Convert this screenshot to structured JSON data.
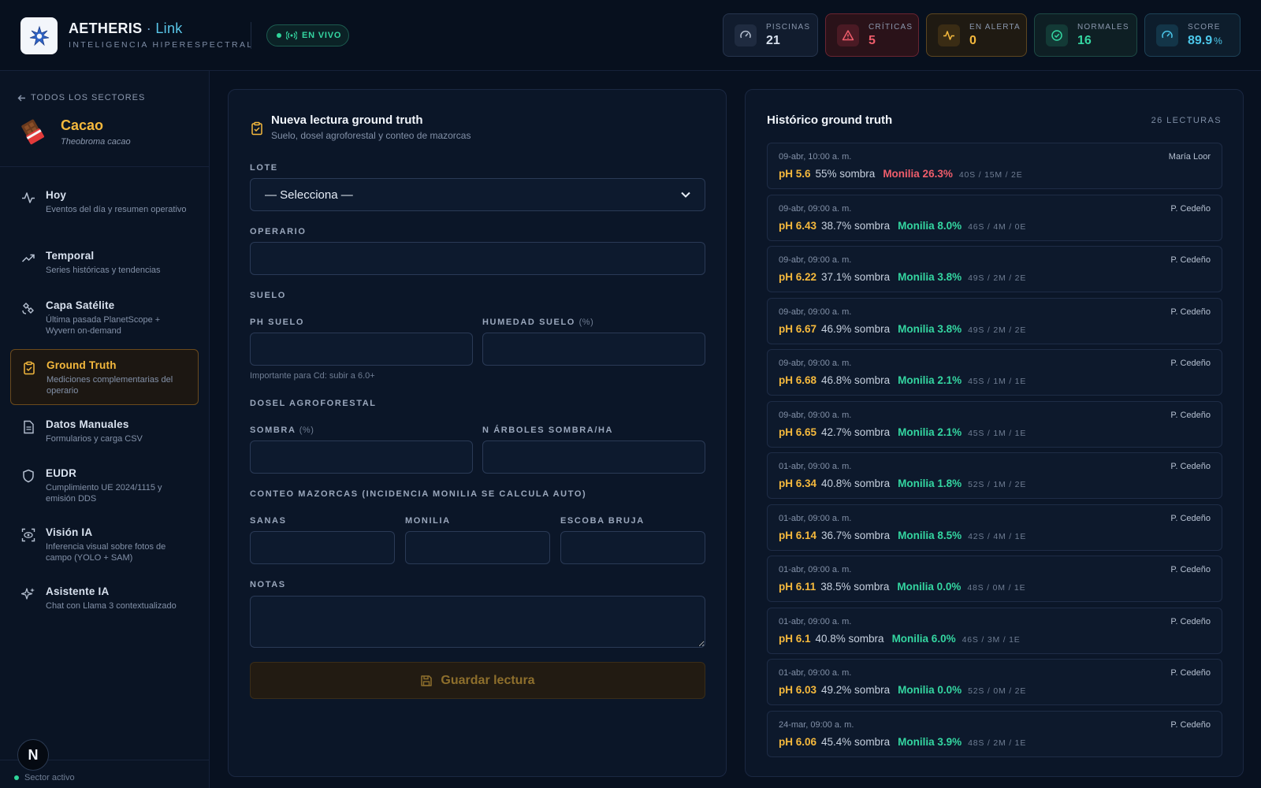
{
  "header": {
    "brand_name": "AETHERIS",
    "brand_sep": "·",
    "brand_link": "Link",
    "brand_sub": "INTELIGENCIA HIPERESPECTRAL",
    "live_label": "EN VIVO",
    "stats": [
      {
        "label": "PISCINAS",
        "value": "21",
        "suffix": "",
        "color": "#d8e1ee",
        "icon": "gauge-icon"
      },
      {
        "label": "CRÍTICAS",
        "value": "5",
        "suffix": "",
        "color": "#ef5d6b",
        "icon": "warning-icon"
      },
      {
        "label": "EN ALERTA",
        "value": "0",
        "suffix": "",
        "color": "#f5b93d",
        "icon": "activity-icon"
      },
      {
        "label": "NORMALES",
        "value": "16",
        "suffix": "",
        "color": "#34d6a1",
        "icon": "check-circle-icon"
      },
      {
        "label": "SCORE",
        "value": "89.9",
        "suffix": "%",
        "color": "#4cc7ea",
        "icon": "gauge-icon"
      }
    ]
  },
  "sidebar": {
    "back_label": "TODOS LOS SECTORES",
    "sector_name": "Cacao",
    "sector_sci": "Theobroma cacao",
    "items": [
      {
        "title": "Hoy",
        "desc": "Eventos del día y resumen operativo"
      },
      {
        "title": "Temporal",
        "desc": "Series históricas y tendencias"
      },
      {
        "title": "Capa Satélite",
        "desc": "Última pasada PlanetScope + Wyvern on-demand"
      },
      {
        "title": "Ground Truth",
        "desc": "Mediciones complementarias del operario"
      },
      {
        "title": "Datos Manuales",
        "desc": "Formularios y carga CSV"
      },
      {
        "title": "EUDR",
        "desc": "Cumplimiento UE 2024/1115 y emisión DDS"
      },
      {
        "title": "Visión IA",
        "desc": "Inferencia visual sobre fotos de campo (YOLO + SAM)"
      },
      {
        "title": "Asistente IA",
        "desc": "Chat con Llama 3 contextualizado"
      }
    ],
    "badge": "N",
    "status": "Sector activo"
  },
  "form": {
    "title": "Nueva lectura ground truth",
    "subtitle": "Suelo, dosel agroforestal y conteo de mazorcas",
    "lote_label": "LOTE",
    "lote_value": "— Selecciona —",
    "operario_label": "OPERARIO",
    "suelo_section": "SUELO",
    "ph_label": "PH SUELO",
    "humedad_label": "HUMEDAD SUELO",
    "humedad_unit": "(%)",
    "ph_hint": "Importante para Cd: subir a 6.0+",
    "dosel_section": "DOSEL AGROFORESTAL",
    "sombra_label": "SOMBRA",
    "sombra_unit": "(%)",
    "arboles_label": "N ÁRBOLES SOMBRA/HA",
    "conteo_section": "CONTEO MAZORCAS (INCIDENCIA MONILIA SE CALCULA AUTO)",
    "sanas_label": "SANAS",
    "monilia_label": "MONILIA",
    "escoba_label": "ESCOBA BRUJA",
    "notas_label": "NOTAS",
    "save_label": "Guardar lectura"
  },
  "history": {
    "title": "Histórico ground truth",
    "count": "26 LECTURAS",
    "records": [
      {
        "date": "09-abr, 10:00 a. m.",
        "op": "María Loor",
        "ph": "pH 5.6",
        "sombra": "55% sombra",
        "mon": "Monilia 26.3%",
        "mon_color": "#ef5d6b",
        "counts": "40S / 15M / 2E"
      },
      {
        "date": "09-abr, 09:00 a. m.",
        "op": "P. Cedeño",
        "ph": "pH 6.43",
        "sombra": "38.7% sombra",
        "mon": "Monilia 8.0%",
        "mon_color": "#34d6a1",
        "counts": "46S / 4M / 0E"
      },
      {
        "date": "09-abr, 09:00 a. m.",
        "op": "P. Cedeño",
        "ph": "pH 6.22",
        "sombra": "37.1% sombra",
        "mon": "Monilia 3.8%",
        "mon_color": "#34d6a1",
        "counts": "49S / 2M / 2E"
      },
      {
        "date": "09-abr, 09:00 a. m.",
        "op": "P. Cedeño",
        "ph": "pH 6.67",
        "sombra": "46.9% sombra",
        "mon": "Monilia 3.8%",
        "mon_color": "#34d6a1",
        "counts": "49S / 2M / 2E"
      },
      {
        "date": "09-abr, 09:00 a. m.",
        "op": "P. Cedeño",
        "ph": "pH 6.68",
        "sombra": "46.8% sombra",
        "mon": "Monilia 2.1%",
        "mon_color": "#34d6a1",
        "counts": "45S / 1M / 1E"
      },
      {
        "date": "09-abr, 09:00 a. m.",
        "op": "P. Cedeño",
        "ph": "pH 6.65",
        "sombra": "42.7% sombra",
        "mon": "Monilia 2.1%",
        "mon_color": "#34d6a1",
        "counts": "45S / 1M / 1E"
      },
      {
        "date": "01-abr, 09:00 a. m.",
        "op": "P. Cedeño",
        "ph": "pH 6.34",
        "sombra": "40.8% sombra",
        "mon": "Monilia 1.8%",
        "mon_color": "#34d6a1",
        "counts": "52S / 1M / 2E"
      },
      {
        "date": "01-abr, 09:00 a. m.",
        "op": "P. Cedeño",
        "ph": "pH 6.14",
        "sombra": "36.7% sombra",
        "mon": "Monilia 8.5%",
        "mon_color": "#34d6a1",
        "counts": "42S / 4M / 1E"
      },
      {
        "date": "01-abr, 09:00 a. m.",
        "op": "P. Cedeño",
        "ph": "pH 6.11",
        "sombra": "38.5% sombra",
        "mon": "Monilia 0.0%",
        "mon_color": "#34d6a1",
        "counts": "48S / 0M / 1E"
      },
      {
        "date": "01-abr, 09:00 a. m.",
        "op": "P. Cedeño",
        "ph": "pH 6.1",
        "sombra": "40.8% sombra",
        "mon": "Monilia 6.0%",
        "mon_color": "#34d6a1",
        "counts": "46S / 3M / 1E"
      },
      {
        "date": "01-abr, 09:00 a. m.",
        "op": "P. Cedeño",
        "ph": "pH 6.03",
        "sombra": "49.2% sombra",
        "mon": "Monilia 0.0%",
        "mon_color": "#34d6a1",
        "counts": "52S / 0M / 2E"
      },
      {
        "date": "24-mar, 09:00 a. m.",
        "op": "P. Cedeño",
        "ph": "pH 6.06",
        "sombra": "45.4% sombra",
        "mon": "Monilia 3.9%",
        "mon_color": "#34d6a1",
        "counts": "48S / 2M / 1E"
      }
    ]
  }
}
